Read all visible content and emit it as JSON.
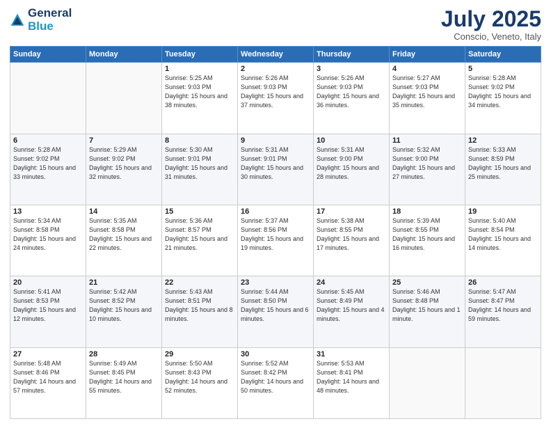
{
  "header": {
    "logo_line1": "General",
    "logo_line2": "Blue",
    "month": "July 2025",
    "location": "Conscio, Veneto, Italy"
  },
  "weekdays": [
    "Sunday",
    "Monday",
    "Tuesday",
    "Wednesday",
    "Thursday",
    "Friday",
    "Saturday"
  ],
  "weeks": [
    [
      {
        "day": "",
        "sunrise": "",
        "sunset": "",
        "daylight": ""
      },
      {
        "day": "",
        "sunrise": "",
        "sunset": "",
        "daylight": ""
      },
      {
        "day": "1",
        "sunrise": "Sunrise: 5:25 AM",
        "sunset": "Sunset: 9:03 PM",
        "daylight": "Daylight: 15 hours and 38 minutes."
      },
      {
        "day": "2",
        "sunrise": "Sunrise: 5:26 AM",
        "sunset": "Sunset: 9:03 PM",
        "daylight": "Daylight: 15 hours and 37 minutes."
      },
      {
        "day": "3",
        "sunrise": "Sunrise: 5:26 AM",
        "sunset": "Sunset: 9:03 PM",
        "daylight": "Daylight: 15 hours and 36 minutes."
      },
      {
        "day": "4",
        "sunrise": "Sunrise: 5:27 AM",
        "sunset": "Sunset: 9:03 PM",
        "daylight": "Daylight: 15 hours and 35 minutes."
      },
      {
        "day": "5",
        "sunrise": "Sunrise: 5:28 AM",
        "sunset": "Sunset: 9:02 PM",
        "daylight": "Daylight: 15 hours and 34 minutes."
      }
    ],
    [
      {
        "day": "6",
        "sunrise": "Sunrise: 5:28 AM",
        "sunset": "Sunset: 9:02 PM",
        "daylight": "Daylight: 15 hours and 33 minutes."
      },
      {
        "day": "7",
        "sunrise": "Sunrise: 5:29 AM",
        "sunset": "Sunset: 9:02 PM",
        "daylight": "Daylight: 15 hours and 32 minutes."
      },
      {
        "day": "8",
        "sunrise": "Sunrise: 5:30 AM",
        "sunset": "Sunset: 9:01 PM",
        "daylight": "Daylight: 15 hours and 31 minutes."
      },
      {
        "day": "9",
        "sunrise": "Sunrise: 5:31 AM",
        "sunset": "Sunset: 9:01 PM",
        "daylight": "Daylight: 15 hours and 30 minutes."
      },
      {
        "day": "10",
        "sunrise": "Sunrise: 5:31 AM",
        "sunset": "Sunset: 9:00 PM",
        "daylight": "Daylight: 15 hours and 28 minutes."
      },
      {
        "day": "11",
        "sunrise": "Sunrise: 5:32 AM",
        "sunset": "Sunset: 9:00 PM",
        "daylight": "Daylight: 15 hours and 27 minutes."
      },
      {
        "day": "12",
        "sunrise": "Sunrise: 5:33 AM",
        "sunset": "Sunset: 8:59 PM",
        "daylight": "Daylight: 15 hours and 25 minutes."
      }
    ],
    [
      {
        "day": "13",
        "sunrise": "Sunrise: 5:34 AM",
        "sunset": "Sunset: 8:58 PM",
        "daylight": "Daylight: 15 hours and 24 minutes."
      },
      {
        "day": "14",
        "sunrise": "Sunrise: 5:35 AM",
        "sunset": "Sunset: 8:58 PM",
        "daylight": "Daylight: 15 hours and 22 minutes."
      },
      {
        "day": "15",
        "sunrise": "Sunrise: 5:36 AM",
        "sunset": "Sunset: 8:57 PM",
        "daylight": "Daylight: 15 hours and 21 minutes."
      },
      {
        "day": "16",
        "sunrise": "Sunrise: 5:37 AM",
        "sunset": "Sunset: 8:56 PM",
        "daylight": "Daylight: 15 hours and 19 minutes."
      },
      {
        "day": "17",
        "sunrise": "Sunrise: 5:38 AM",
        "sunset": "Sunset: 8:55 PM",
        "daylight": "Daylight: 15 hours and 17 minutes."
      },
      {
        "day": "18",
        "sunrise": "Sunrise: 5:39 AM",
        "sunset": "Sunset: 8:55 PM",
        "daylight": "Daylight: 15 hours and 16 minutes."
      },
      {
        "day": "19",
        "sunrise": "Sunrise: 5:40 AM",
        "sunset": "Sunset: 8:54 PM",
        "daylight": "Daylight: 15 hours and 14 minutes."
      }
    ],
    [
      {
        "day": "20",
        "sunrise": "Sunrise: 5:41 AM",
        "sunset": "Sunset: 8:53 PM",
        "daylight": "Daylight: 15 hours and 12 minutes."
      },
      {
        "day": "21",
        "sunrise": "Sunrise: 5:42 AM",
        "sunset": "Sunset: 8:52 PM",
        "daylight": "Daylight: 15 hours and 10 minutes."
      },
      {
        "day": "22",
        "sunrise": "Sunrise: 5:43 AM",
        "sunset": "Sunset: 8:51 PM",
        "daylight": "Daylight: 15 hours and 8 minutes."
      },
      {
        "day": "23",
        "sunrise": "Sunrise: 5:44 AM",
        "sunset": "Sunset: 8:50 PM",
        "daylight": "Daylight: 15 hours and 6 minutes."
      },
      {
        "day": "24",
        "sunrise": "Sunrise: 5:45 AM",
        "sunset": "Sunset: 8:49 PM",
        "daylight": "Daylight: 15 hours and 4 minutes."
      },
      {
        "day": "25",
        "sunrise": "Sunrise: 5:46 AM",
        "sunset": "Sunset: 8:48 PM",
        "daylight": "Daylight: 15 hours and 1 minute."
      },
      {
        "day": "26",
        "sunrise": "Sunrise: 5:47 AM",
        "sunset": "Sunset: 8:47 PM",
        "daylight": "Daylight: 14 hours and 59 minutes."
      }
    ],
    [
      {
        "day": "27",
        "sunrise": "Sunrise: 5:48 AM",
        "sunset": "Sunset: 8:46 PM",
        "daylight": "Daylight: 14 hours and 57 minutes."
      },
      {
        "day": "28",
        "sunrise": "Sunrise: 5:49 AM",
        "sunset": "Sunset: 8:45 PM",
        "daylight": "Daylight: 14 hours and 55 minutes."
      },
      {
        "day": "29",
        "sunrise": "Sunrise: 5:50 AM",
        "sunset": "Sunset: 8:43 PM",
        "daylight": "Daylight: 14 hours and 52 minutes."
      },
      {
        "day": "30",
        "sunrise": "Sunrise: 5:52 AM",
        "sunset": "Sunset: 8:42 PM",
        "daylight": "Daylight: 14 hours and 50 minutes."
      },
      {
        "day": "31",
        "sunrise": "Sunrise: 5:53 AM",
        "sunset": "Sunset: 8:41 PM",
        "daylight": "Daylight: 14 hours and 48 minutes."
      },
      {
        "day": "",
        "sunrise": "",
        "sunset": "",
        "daylight": ""
      },
      {
        "day": "",
        "sunrise": "",
        "sunset": "",
        "daylight": ""
      }
    ]
  ]
}
